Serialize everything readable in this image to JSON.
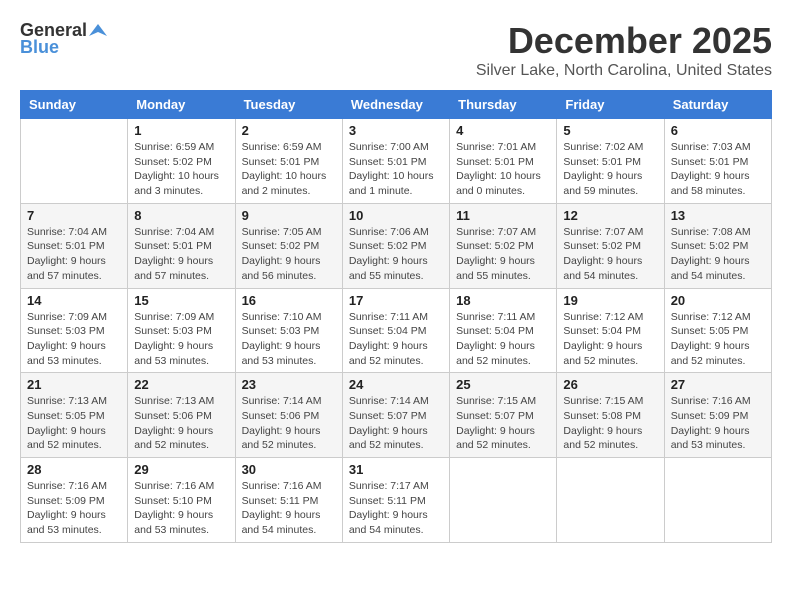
{
  "header": {
    "logo_general": "General",
    "logo_blue": "Blue",
    "month": "December 2025",
    "location": "Silver Lake, North Carolina, United States"
  },
  "weekdays": [
    "Sunday",
    "Monday",
    "Tuesday",
    "Wednesday",
    "Thursday",
    "Friday",
    "Saturday"
  ],
  "weeks": [
    [
      {
        "day": "",
        "info": ""
      },
      {
        "day": "1",
        "info": "Sunrise: 6:59 AM\nSunset: 5:02 PM\nDaylight: 10 hours\nand 3 minutes."
      },
      {
        "day": "2",
        "info": "Sunrise: 6:59 AM\nSunset: 5:01 PM\nDaylight: 10 hours\nand 2 minutes."
      },
      {
        "day": "3",
        "info": "Sunrise: 7:00 AM\nSunset: 5:01 PM\nDaylight: 10 hours\nand 1 minute."
      },
      {
        "day": "4",
        "info": "Sunrise: 7:01 AM\nSunset: 5:01 PM\nDaylight: 10 hours\nand 0 minutes."
      },
      {
        "day": "5",
        "info": "Sunrise: 7:02 AM\nSunset: 5:01 PM\nDaylight: 9 hours\nand 59 minutes."
      },
      {
        "day": "6",
        "info": "Sunrise: 7:03 AM\nSunset: 5:01 PM\nDaylight: 9 hours\nand 58 minutes."
      }
    ],
    [
      {
        "day": "7",
        "info": "Sunrise: 7:04 AM\nSunset: 5:01 PM\nDaylight: 9 hours\nand 57 minutes."
      },
      {
        "day": "8",
        "info": "Sunrise: 7:04 AM\nSunset: 5:01 PM\nDaylight: 9 hours\nand 57 minutes."
      },
      {
        "day": "9",
        "info": "Sunrise: 7:05 AM\nSunset: 5:02 PM\nDaylight: 9 hours\nand 56 minutes."
      },
      {
        "day": "10",
        "info": "Sunrise: 7:06 AM\nSunset: 5:02 PM\nDaylight: 9 hours\nand 55 minutes."
      },
      {
        "day": "11",
        "info": "Sunrise: 7:07 AM\nSunset: 5:02 PM\nDaylight: 9 hours\nand 55 minutes."
      },
      {
        "day": "12",
        "info": "Sunrise: 7:07 AM\nSunset: 5:02 PM\nDaylight: 9 hours\nand 54 minutes."
      },
      {
        "day": "13",
        "info": "Sunrise: 7:08 AM\nSunset: 5:02 PM\nDaylight: 9 hours\nand 54 minutes."
      }
    ],
    [
      {
        "day": "14",
        "info": "Sunrise: 7:09 AM\nSunset: 5:03 PM\nDaylight: 9 hours\nand 53 minutes."
      },
      {
        "day": "15",
        "info": "Sunrise: 7:09 AM\nSunset: 5:03 PM\nDaylight: 9 hours\nand 53 minutes."
      },
      {
        "day": "16",
        "info": "Sunrise: 7:10 AM\nSunset: 5:03 PM\nDaylight: 9 hours\nand 53 minutes."
      },
      {
        "day": "17",
        "info": "Sunrise: 7:11 AM\nSunset: 5:04 PM\nDaylight: 9 hours\nand 52 minutes."
      },
      {
        "day": "18",
        "info": "Sunrise: 7:11 AM\nSunset: 5:04 PM\nDaylight: 9 hours\nand 52 minutes."
      },
      {
        "day": "19",
        "info": "Sunrise: 7:12 AM\nSunset: 5:04 PM\nDaylight: 9 hours\nand 52 minutes."
      },
      {
        "day": "20",
        "info": "Sunrise: 7:12 AM\nSunset: 5:05 PM\nDaylight: 9 hours\nand 52 minutes."
      }
    ],
    [
      {
        "day": "21",
        "info": "Sunrise: 7:13 AM\nSunset: 5:05 PM\nDaylight: 9 hours\nand 52 minutes."
      },
      {
        "day": "22",
        "info": "Sunrise: 7:13 AM\nSunset: 5:06 PM\nDaylight: 9 hours\nand 52 minutes."
      },
      {
        "day": "23",
        "info": "Sunrise: 7:14 AM\nSunset: 5:06 PM\nDaylight: 9 hours\nand 52 minutes."
      },
      {
        "day": "24",
        "info": "Sunrise: 7:14 AM\nSunset: 5:07 PM\nDaylight: 9 hours\nand 52 minutes."
      },
      {
        "day": "25",
        "info": "Sunrise: 7:15 AM\nSunset: 5:07 PM\nDaylight: 9 hours\nand 52 minutes."
      },
      {
        "day": "26",
        "info": "Sunrise: 7:15 AM\nSunset: 5:08 PM\nDaylight: 9 hours\nand 52 minutes."
      },
      {
        "day": "27",
        "info": "Sunrise: 7:16 AM\nSunset: 5:09 PM\nDaylight: 9 hours\nand 53 minutes."
      }
    ],
    [
      {
        "day": "28",
        "info": "Sunrise: 7:16 AM\nSunset: 5:09 PM\nDaylight: 9 hours\nand 53 minutes."
      },
      {
        "day": "29",
        "info": "Sunrise: 7:16 AM\nSunset: 5:10 PM\nDaylight: 9 hours\nand 53 minutes."
      },
      {
        "day": "30",
        "info": "Sunrise: 7:16 AM\nSunset: 5:11 PM\nDaylight: 9 hours\nand 54 minutes."
      },
      {
        "day": "31",
        "info": "Sunrise: 7:17 AM\nSunset: 5:11 PM\nDaylight: 9 hours\nand 54 minutes."
      },
      {
        "day": "",
        "info": ""
      },
      {
        "day": "",
        "info": ""
      },
      {
        "day": "",
        "info": ""
      }
    ]
  ]
}
